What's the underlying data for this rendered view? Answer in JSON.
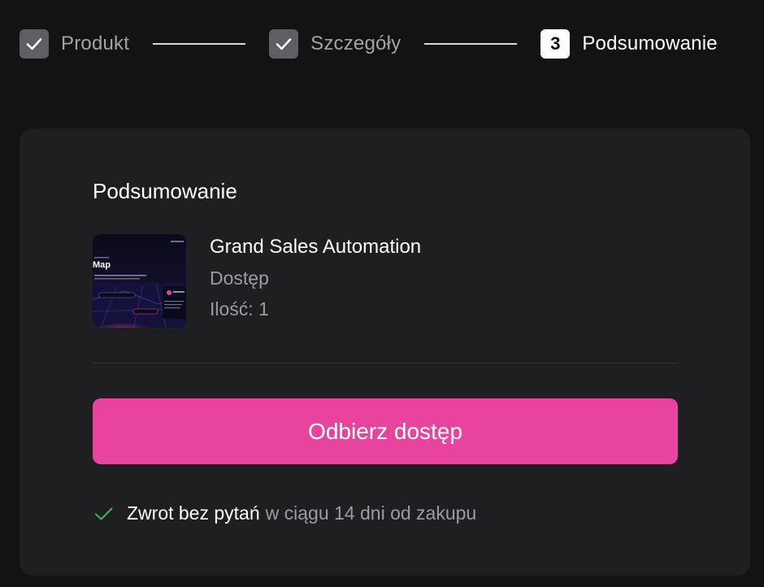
{
  "stepper": {
    "steps": [
      {
        "label": "Produkt",
        "state": "done",
        "icon": "check-icon"
      },
      {
        "label": "Szczegóły",
        "state": "done",
        "icon": "check-icon"
      },
      {
        "label": "Podsumowanie",
        "state": "active",
        "number": "3"
      }
    ]
  },
  "summary": {
    "title": "Podsumowanie",
    "product": {
      "name": "Grand Sales Automation",
      "type": "Dostęp",
      "quantity": "Ilość: 1",
      "thumbnail_heading": "Map"
    },
    "cta_label": "Odbierz dostęp",
    "guarantee": {
      "icon": "check-icon",
      "strong": "Zwrot bez pytań",
      "rest": "w ciągu 14 dni od zakupu"
    }
  },
  "colors": {
    "background": "#131314",
    "card": "#1f1f22",
    "accent": "#e8449e",
    "success": "#3fae64",
    "muted_text": "#9c9ca1"
  }
}
